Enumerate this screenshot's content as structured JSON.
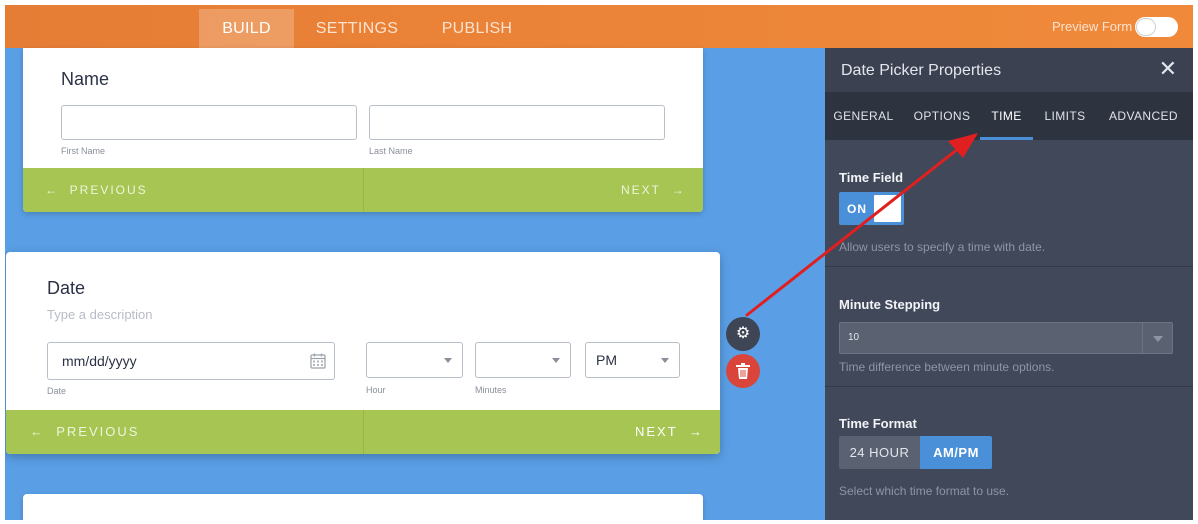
{
  "topbar": {
    "tabs": [
      "BUILD",
      "SETTINGS",
      "PUBLISH"
    ],
    "active_tab": "BUILD",
    "preview_label": "Preview Form",
    "preview_on": false
  },
  "form": {
    "name_card": {
      "title": "Name",
      "first_label": "First Name",
      "last_label": "Last Name",
      "prev_label": "PREVIOUS",
      "next_label": "NEXT"
    },
    "date_card": {
      "title": "Date",
      "description_placeholder": "Type a description",
      "date_placeholder": "mm/dd/yyyy",
      "date_label": "Date",
      "hour_label": "Hour",
      "minutes_label": "Minutes",
      "ampm_value": "PM",
      "prev_label": "PREVIOUS",
      "next_label": "NEXT"
    }
  },
  "panel": {
    "title": "Date Picker Properties",
    "tabs": [
      "GENERAL",
      "OPTIONS",
      "TIME",
      "LIMITS",
      "ADVANCED"
    ],
    "active_tab": "TIME",
    "time_field": {
      "title": "Time Field",
      "toggle_label": "ON",
      "help": "Allow users to specify a time with date."
    },
    "minute_stepping": {
      "title": "Minute Stepping",
      "value": "10",
      "help": "Time difference between minute options."
    },
    "time_format": {
      "title": "Time Format",
      "options": [
        "24 HOUR",
        "AM/PM"
      ],
      "selected": "AM/PM",
      "help": "Select which time format to use."
    }
  },
  "colors": {
    "topbar": "#f08a3a",
    "canvas": "#5a9fe6",
    "pager": "#a6c552",
    "panel": "#414859",
    "accent": "#4a90d9",
    "annotation_arrow": "#e02020",
    "delete": "#d9453b"
  }
}
